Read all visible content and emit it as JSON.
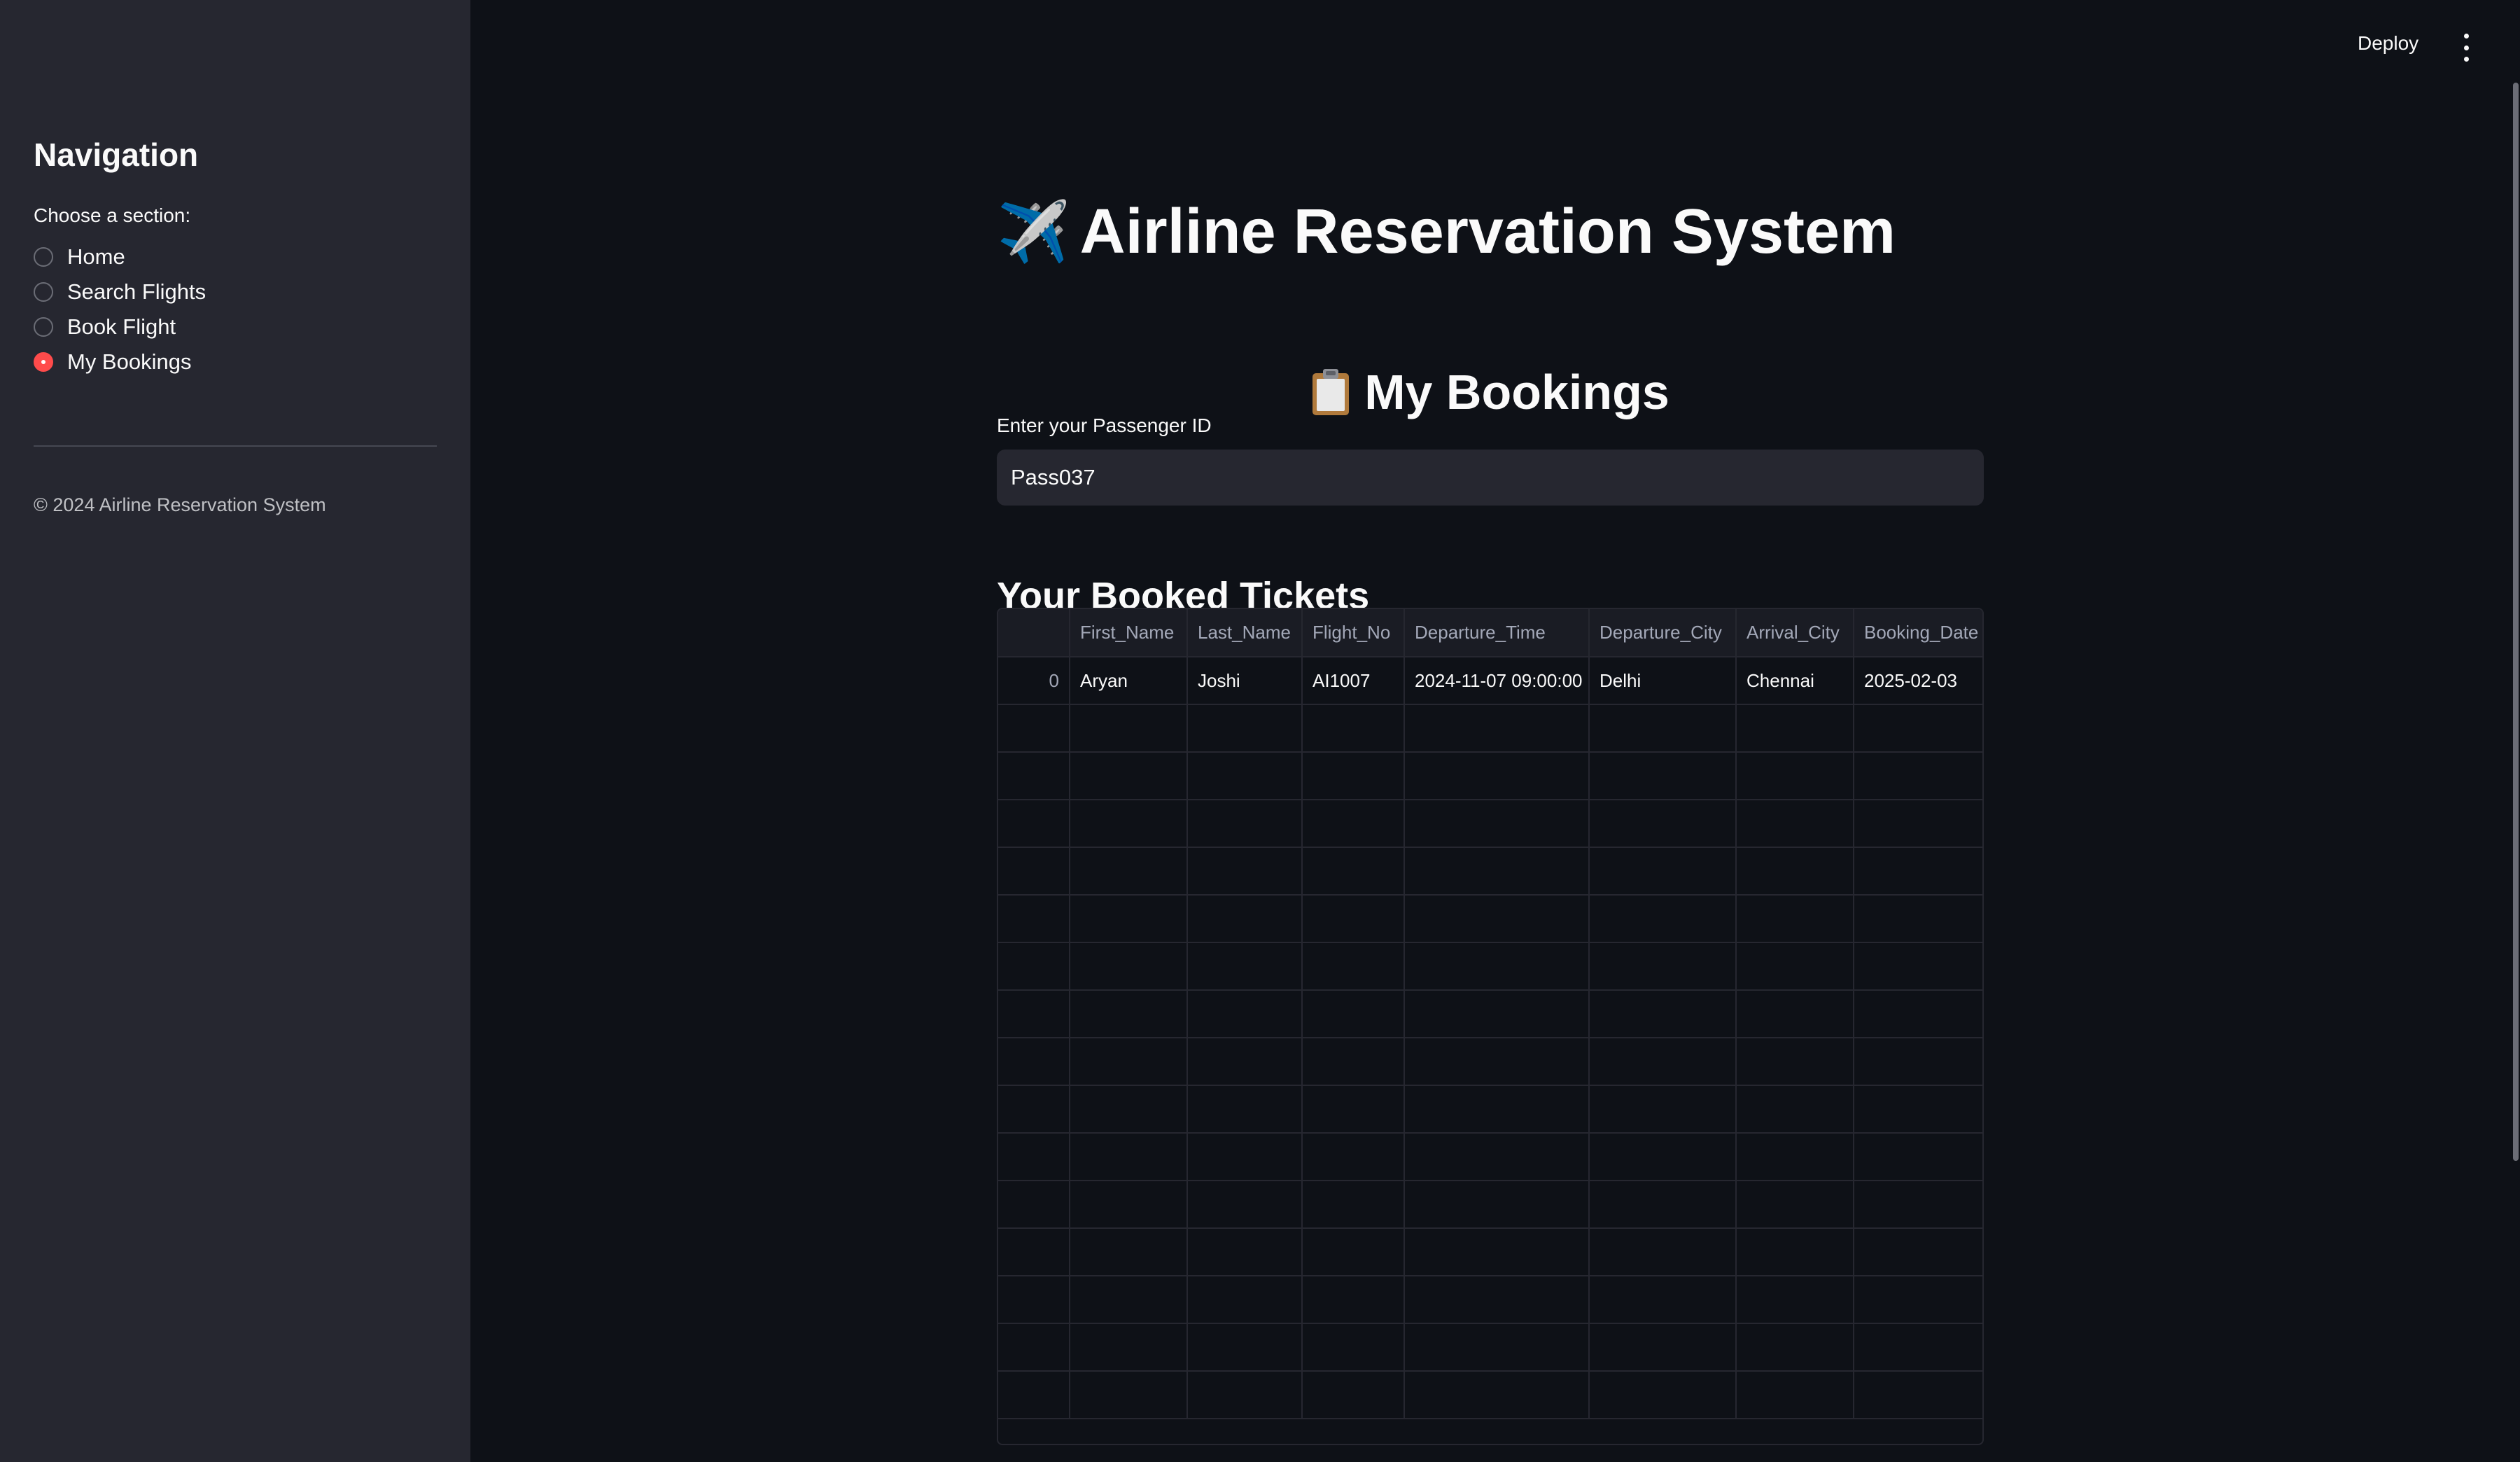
{
  "sidebar": {
    "title": "Navigation",
    "subtitle": "Choose a section:",
    "options": [
      {
        "label": "Home",
        "selected": false
      },
      {
        "label": "Search Flights",
        "selected": false
      },
      {
        "label": "Book Flight",
        "selected": false
      },
      {
        "label": "My Bookings",
        "selected": true
      }
    ],
    "footer": "© 2024 Airline Reservation System"
  },
  "header": {
    "deploy_label": "Deploy",
    "menu_icon": "kebab-menu-icon"
  },
  "main": {
    "app_icon": "✈️",
    "app_title": "Airline Reservation System",
    "section_icon": "clipboard-icon",
    "section_title": "My Bookings",
    "input_label": "Enter your Passenger ID",
    "input_value": "Pass037",
    "tickets_heading": "Your Booked Tickets",
    "table": {
      "columns": [
        "",
        "First_Name",
        "Last_Name",
        "Flight_No",
        "Departure_Time",
        "Departure_City",
        "Arrival_City",
        "Booking_Date"
      ],
      "rows": [
        [
          "0",
          "Aryan",
          "Joshi",
          "AI1007",
          "2024-11-07 09:00:00",
          "Delhi",
          "Chennai",
          "2025-02-03"
        ]
      ]
    }
  },
  "colors": {
    "accent": "#ff4b4b",
    "sidebar_bg": "#262730",
    "main_bg": "#0e1117"
  }
}
